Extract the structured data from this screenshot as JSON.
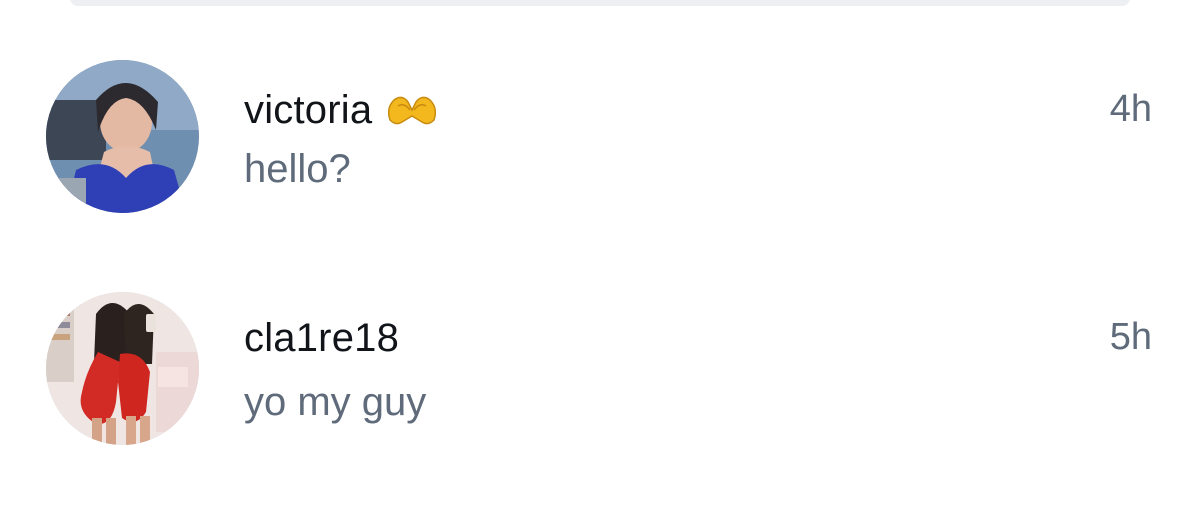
{
  "conversations": [
    {
      "username": "victoria",
      "name_emoji": "heart-hands-emoji",
      "preview": "hello?",
      "time": "4h"
    },
    {
      "username": "cla1re18",
      "preview": "yo my guy",
      "time": "5h"
    }
  ],
  "colors": {
    "username": "#111418",
    "secondary_text": "#5f6b7a",
    "search_bar": "#eeeff2"
  }
}
